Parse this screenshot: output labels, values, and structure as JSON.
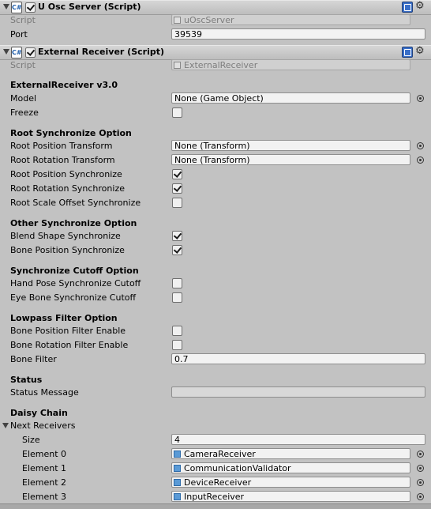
{
  "osc": {
    "title": "U Osc Server (Script)",
    "script_label": "Script",
    "script_value": "uOscServer",
    "port_label": "Port",
    "port_value": "39539"
  },
  "ext": {
    "title": "External Receiver (Script)",
    "script_label": "Script",
    "script_value": "ExternalReceiver",
    "version": "ExternalReceiver v3.0",
    "model_label": "Model",
    "model_value": "None (Game Object)",
    "freeze_label": "Freeze",
    "root_sync_header": "Root Synchronize Option",
    "root_pos_tf_label": "Root Position Transform",
    "root_pos_tf_value": "None (Transform)",
    "root_rot_tf_label": "Root Rotation Transform",
    "root_rot_tf_value": "None (Transform)",
    "root_pos_sync_label": "Root Position Synchronize",
    "root_rot_sync_label": "Root Rotation Synchronize",
    "root_scale_sync_label": "Root Scale Offset Synchronize",
    "other_sync_header": "Other Synchronize Option",
    "blend_sync_label": "Blend Shape Synchronize",
    "bone_pos_sync_label": "Bone Position Synchronize",
    "cutoff_header": "Synchronize Cutoff Option",
    "hand_cutoff_label": "Hand Pose Synchronize Cutoff",
    "eye_cutoff_label": "Eye Bone Synchronize Cutoff",
    "lowpass_header": "Lowpass Filter Option",
    "bone_pos_filter_label": "Bone Position Filter Enable",
    "bone_rot_filter_label": "Bone Rotation Filter Enable",
    "bone_filter_label": "Bone Filter",
    "bone_filter_value": "0.7",
    "status_header": "Status",
    "status_msg_label": "Status Message",
    "status_msg_value": "",
    "daisy_header": "Daisy Chain",
    "next_receivers_label": "Next Receivers",
    "size_label": "Size",
    "size_value": "4",
    "elements": [
      {
        "label": "Element 0",
        "value": "CameraReceiver"
      },
      {
        "label": "Element 1",
        "value": "CommunicationValidator"
      },
      {
        "label": "Element 2",
        "value": "DeviceReceiver"
      },
      {
        "label": "Element 3",
        "value": "InputReceiver"
      }
    ]
  },
  "checkboxes": {
    "osc_enabled": true,
    "ext_enabled": true,
    "freeze": false,
    "root_pos_sync": true,
    "root_rot_sync": true,
    "root_scale_sync": false,
    "blend_sync": true,
    "bone_pos_sync": true,
    "hand_cutoff": false,
    "eye_cutoff": false,
    "bone_pos_filter": false,
    "bone_rot_filter": false
  },
  "icons": {
    "script": "script-icon",
    "help": "help-icon",
    "settings": "gear-icon",
    "picker": "object-picker-icon",
    "object": "prefab-object-icon",
    "fold": "foldout-arrow-icon"
  },
  "colors": {
    "panel_bg": "#c2c2c2",
    "field_bg": "#f2f2f2",
    "readonly_text": "#7d7d7d",
    "object_icon": "#5a9ad6"
  }
}
